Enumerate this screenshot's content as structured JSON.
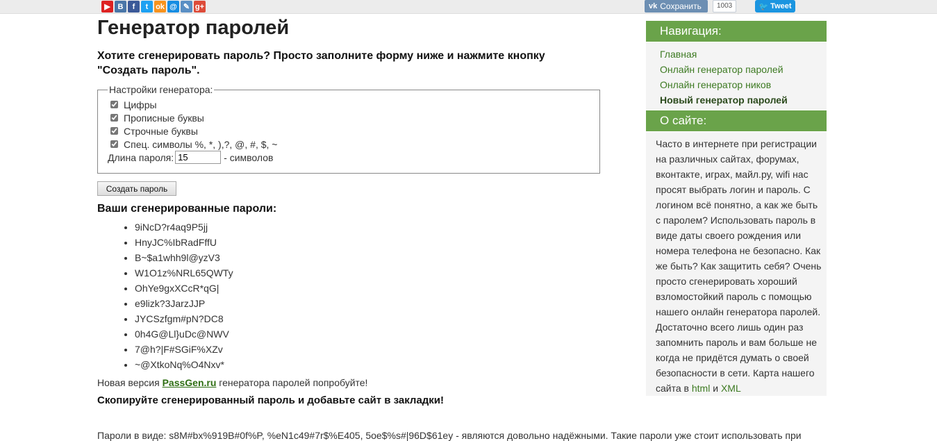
{
  "share": {
    "icons": [
      {
        "name": "youtube-icon",
        "glyph": "▶",
        "color": "#d22"
      },
      {
        "name": "vk-icon",
        "glyph": "В",
        "color": "#4a76a8"
      },
      {
        "name": "facebook-icon",
        "glyph": "f",
        "color": "#3b5998"
      },
      {
        "name": "twitter-icon",
        "glyph": "t",
        "color": "#1da1f2"
      },
      {
        "name": "odnoklassniki-icon",
        "glyph": "ok",
        "color": "#f7931e"
      },
      {
        "name": "mail-icon",
        "glyph": "@",
        "color": "#168de2"
      },
      {
        "name": "livejournal-icon",
        "glyph": "✎",
        "color": "#5a8fc4"
      },
      {
        "name": "google-plus-icon",
        "glyph": "g+",
        "color": "#dd4b39"
      }
    ],
    "vk_save_label": "Сохранить",
    "vk_count": "1003",
    "tweet_label": "Tweet"
  },
  "main": {
    "title": "Генератор паролей",
    "lead": "Хотите сгенерировать пароль? Просто заполните форму ниже и нажмите кнопку \"Создать пароль\".",
    "settings": {
      "legend": "Настройки генератора:",
      "options": [
        {
          "label": "Цифры",
          "checked": true
        },
        {
          "label": "Прописные буквы",
          "checked": true
        },
        {
          "label": "Строчные буквы",
          "checked": true
        },
        {
          "label": "Спец. символы %, *, ),?, @, #, $, ~",
          "checked": true
        }
      ],
      "length_label": "Длина пароля:",
      "length_value": "15",
      "length_suffix": "- символов"
    },
    "generate_button": "Создать пароль",
    "results_title": "Ваши сгенерированные пароли:",
    "passwords": [
      "9iNcD?r4aq9P5jj",
      "HnyJC%IbRadFffU",
      "B~$a1whh9l@yzV3",
      "W1O1z%NRL65QWTy",
      "OhYe9gxXCcR*qG|",
      "e9lizk?3JarzJJP",
      "JYCSzfgm#pN?DC8",
      "0h4G@Ll}uDc@NWV",
      "7@h?|F#SGiF%XZv",
      "~@XtkoNq%O4Nxv*"
    ],
    "new_version_prefix": "Новая версия ",
    "new_version_link": "PassGen.ru",
    "new_version_suffix": " генератора паролей попробуйте!",
    "copy_text": "Скопируйте сгенерированный пароль и добавьте сайт в закладки!",
    "bottom_text": "Пароли в виде: s8M#bx%919B#0f%P, %eN1c49#7r$%E405, 5oe$%s#|96D$61ey - являются довольно надёжными. Такие пароли уже стоит использовать при"
  },
  "sidebar": {
    "nav_title": "Навигация:",
    "nav_items": [
      {
        "label": "Главная",
        "current": false
      },
      {
        "label": "Онлайн генератор паролей",
        "current": false
      },
      {
        "label": "Онлайн генератор ников",
        "current": false
      },
      {
        "label": "Новый генератор паролей",
        "current": true
      }
    ],
    "about_title": "О сайте:",
    "about_text": "Часто в интернете при регистрации на различных сайтах, форумах, вконтакте, играх, майл.ру, wifi нас просят выбрать логин и пароль. С логином всё понятно, а как же быть с паролем? Использовать пароль в виде даты своего рождения или номера телефона не безопасно. Как же быть? Как защитить себя? Очень просто сгенерировать хороший взломостойкий пароль с помощью нашего онлайн генератора паролей. Достаточно всего лишь один раз запомнить пароль и вам больше не когда не придётся думать о своей безопасности в сети. Карта нашего сайта в ",
    "about_link_html": "html",
    "about_and": " и ",
    "about_link_xml": "XML"
  }
}
